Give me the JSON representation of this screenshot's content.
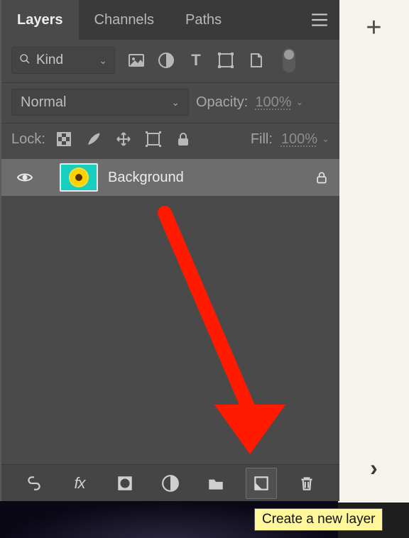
{
  "tabs": {
    "layers": "Layers",
    "channels": "Channels",
    "paths": "Paths"
  },
  "filter": {
    "kind_label": "Kind"
  },
  "blend": {
    "mode": "Normal",
    "opacity_label": "Opacity:",
    "opacity_value": "100%"
  },
  "lock": {
    "label": "Lock:",
    "fill_label": "Fill:",
    "fill_value": "100%"
  },
  "layers": [
    {
      "name": "Background",
      "locked": true
    }
  ],
  "tooltip": "Create a new layer"
}
